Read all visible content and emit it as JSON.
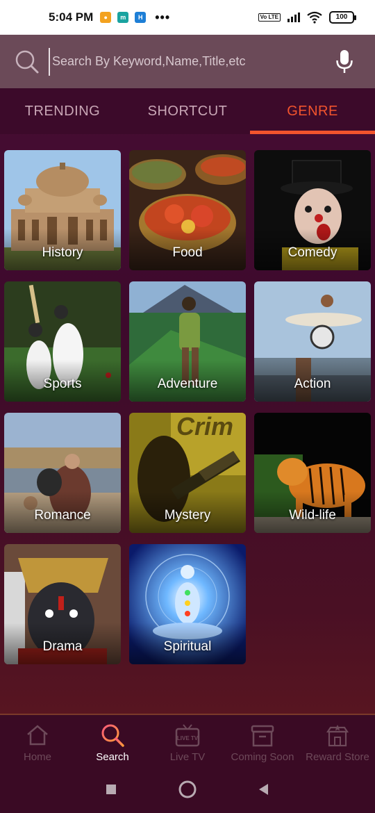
{
  "status_bar": {
    "time": "5:04 PM",
    "dots": "•••",
    "battery": "100",
    "volte": "Vo LTE"
  },
  "search": {
    "placeholder": "Search By Keyword,Name,Title,etc"
  },
  "tabs": [
    {
      "label": "TRENDING",
      "active": false
    },
    {
      "label": "SHORTCUT",
      "active": false
    },
    {
      "label": "GENRE",
      "active": true
    }
  ],
  "genres": [
    {
      "label": "History"
    },
    {
      "label": "Food"
    },
    {
      "label": "Comedy"
    },
    {
      "label": "Sports"
    },
    {
      "label": "Adventure"
    },
    {
      "label": "Action"
    },
    {
      "label": "Romance"
    },
    {
      "label": "Mystery"
    },
    {
      "label": "Wild-life"
    },
    {
      "label": "Drama"
    },
    {
      "label": "Spiritual"
    }
  ],
  "mystery_art_text": "Crim",
  "bottom_nav": [
    {
      "label": "Home",
      "icon": "home-icon",
      "active": false
    },
    {
      "label": "Search",
      "icon": "search-icon",
      "active": true
    },
    {
      "label": "Live TV",
      "icon": "live-tv-icon",
      "active": false,
      "icon_text": "LIVE TV"
    },
    {
      "label": "Coming Soon",
      "icon": "coming-soon-icon",
      "active": false
    },
    {
      "label": "Reward Store",
      "icon": "reward-store-icon",
      "active": false
    }
  ],
  "colors": {
    "accent": "#f2542d",
    "background": "#4a0d35",
    "tab_bar": "#3c0a2a",
    "search_bar": "#6b4a58",
    "inactive_nav": "#6e4a5a"
  }
}
